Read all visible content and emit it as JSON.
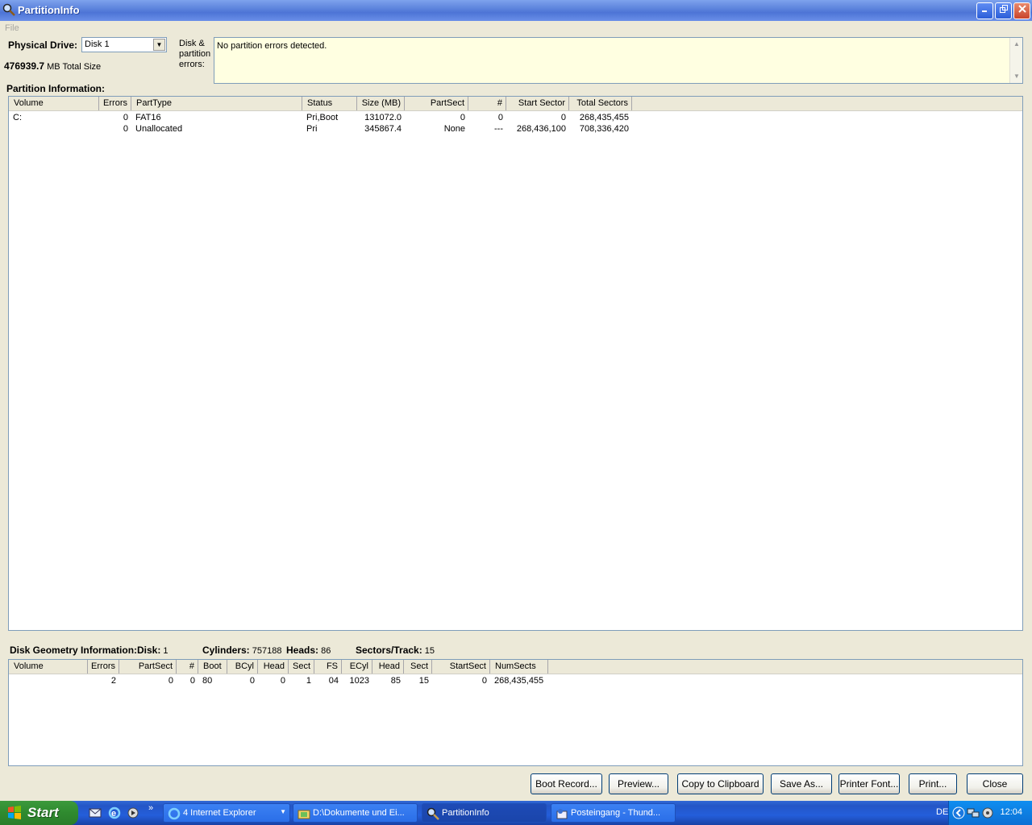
{
  "window": {
    "title": "PartitionInfo",
    "menu_file": "File"
  },
  "drive": {
    "label": "Physical Drive:",
    "selected": "Disk 1",
    "total_size_value": "476939.7",
    "total_size_unit": "MB Total Size"
  },
  "errors": {
    "label": "Disk & partition errors:",
    "text": "No partition errors detected."
  },
  "partition_info": {
    "title": "Partition Information:",
    "columns": [
      "Volume",
      "Errors",
      "PartType",
      "Status",
      "Size (MB)",
      "PartSect",
      "#",
      "Start Sector",
      "Total Sectors"
    ],
    "rows": [
      [
        "C:",
        "0",
        "FAT16",
        "Pri,Boot",
        "131072.0",
        "0",
        "0",
        "0",
        "268,435,455"
      ],
      [
        "",
        "0",
        "Unallocated",
        "Pri",
        "345867.4",
        "None",
        "---",
        "268,436,100",
        "708,336,420"
      ]
    ]
  },
  "geometry": {
    "title": "Disk Geometry Information:",
    "disk_label": "Disk:",
    "disk_value": "1",
    "cylinders_label": "Cylinders:",
    "cylinders_value": "757188",
    "heads_label": "Heads:",
    "heads_value": "86",
    "sectors_label": "Sectors/Track:",
    "sectors_value": "15",
    "columns": [
      "Volume",
      "Errors",
      "PartSect",
      "#",
      "Boot",
      "BCyl",
      "Head",
      "Sect",
      "FS",
      "ECyl",
      "Head",
      "Sect",
      "StartSect",
      "NumSects"
    ],
    "rows": [
      [
        "",
        "2",
        "0",
        "0",
        "80",
        "0",
        "0",
        "1",
        "04",
        "1023",
        "85",
        "15",
        "0",
        "268,435,455"
      ]
    ]
  },
  "buttons": {
    "boot_record": "Boot Record...",
    "preview": "Preview...",
    "copy": "Copy to Clipboard",
    "save_as": "Save As...",
    "printer_font": "Printer Font...",
    "print": "Print...",
    "close": "Close"
  },
  "taskbar": {
    "start": "Start",
    "items": [
      {
        "label": "4 Internet Explorer",
        "icon": "ie-icon"
      },
      {
        "label": "D:\\Dokumente und Ei...",
        "icon": "folder-icon"
      },
      {
        "label": "PartitionInfo",
        "icon": "partitioninfo-icon"
      },
      {
        "label": "Posteingang - Thund...",
        "icon": "thunderbird-icon"
      }
    ],
    "lang": "DE",
    "clock": "12:04"
  },
  "colors": {
    "titlebar": "#4d74d6",
    "error_box_bg": "#ffffe1",
    "taskbar": "#245edb",
    "start_button": "#2f8a2f"
  }
}
